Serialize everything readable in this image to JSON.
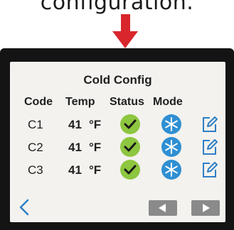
{
  "caption": "configuration.",
  "screen": {
    "title": "Cold Config",
    "headers": {
      "code": "Code",
      "temp": "Temp",
      "status": "Status",
      "mode": "Mode"
    },
    "rows": [
      {
        "code": "C1",
        "temp": "41",
        "unit": "°F",
        "status": "check-icon",
        "mode": "snowflake-icon",
        "action": "edit-icon"
      },
      {
        "code": "C2",
        "temp": "41",
        "unit": "°F",
        "status": "check-icon",
        "mode": "snowflake-icon",
        "action": "edit-icon"
      },
      {
        "code": "C3",
        "temp": "41",
        "unit": "°F",
        "status": "check-icon",
        "mode": "snowflake-icon",
        "action": "edit-icon"
      }
    ],
    "nav": {
      "back": "chevron-left-icon",
      "prev": "triangle-left-icon",
      "next": "triangle-right-icon"
    }
  },
  "colors": {
    "arrow": "#d9262c",
    "status_ok": "#8dc63f",
    "mode_cold": "#2f8fd3",
    "edit": "#2f7fc6",
    "nav_button": "#8a8a8a",
    "bezel": "#141414",
    "screen_bg": "#f3f2ee"
  }
}
